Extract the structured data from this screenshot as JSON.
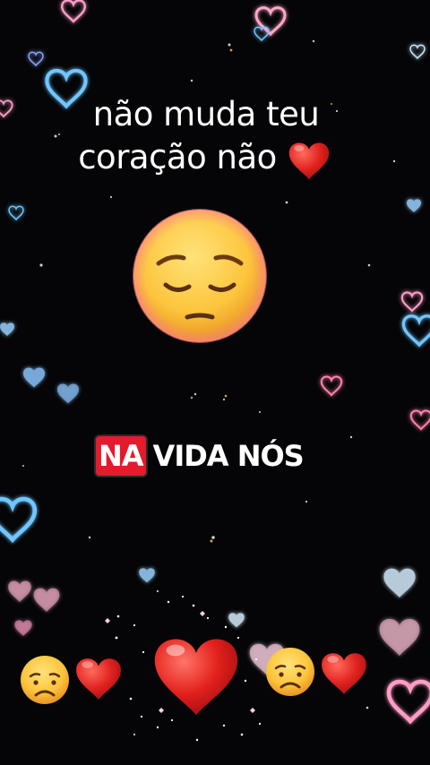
{
  "caption": {
    "line1": "não muda teu",
    "line2": "coração não"
  },
  "subtitle": {
    "highlighted": "NA",
    "rest": "VIDA NÓS"
  },
  "icons": {
    "caption_heart": "red-heart-icon",
    "center_face": "pensive-face-icon",
    "bottom_row": [
      "disappointed-face-icon",
      "red-heart-icon",
      "big-red-heart-icon",
      "disappointed-face-icon",
      "red-heart-icon"
    ],
    "background": "glowing-hearts-background"
  },
  "colors": {
    "background": "#050507",
    "heart_red": "#e0221f",
    "highlight_red": "#e31b2d",
    "neon_blue": "#6fc6ff",
    "neon_pink": "#ff9cc6"
  }
}
